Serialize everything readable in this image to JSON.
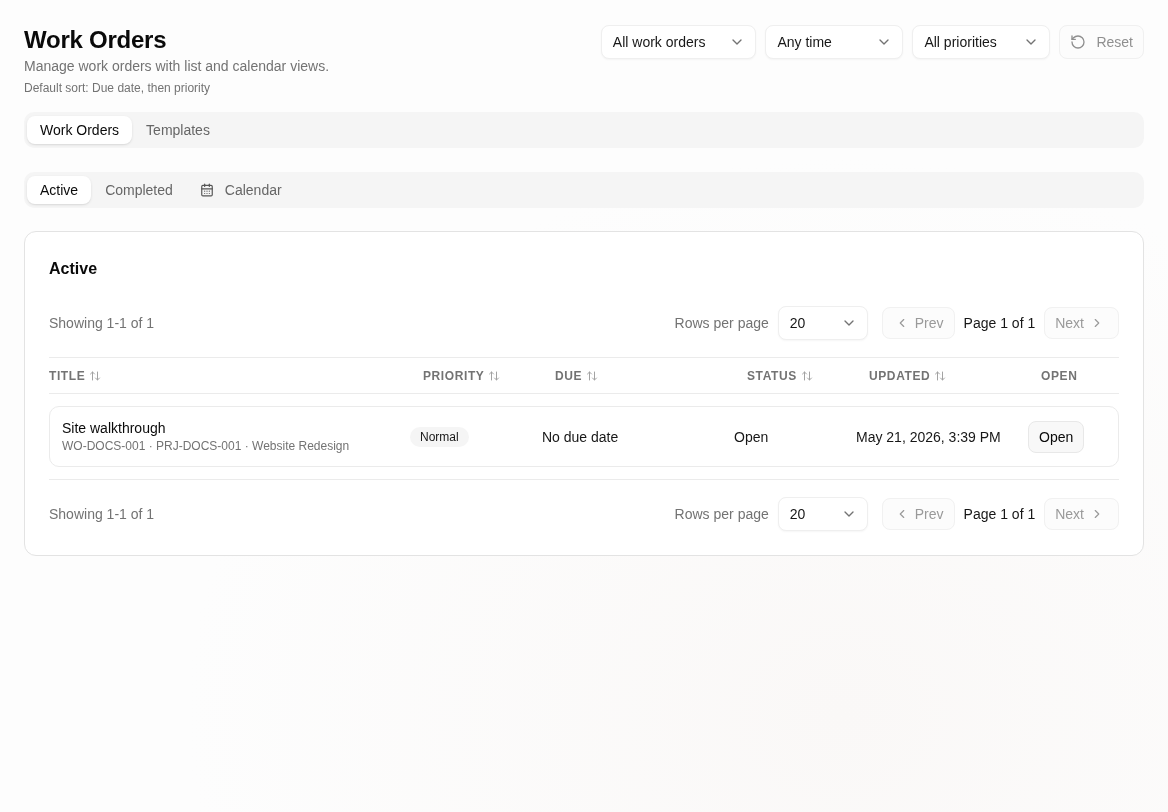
{
  "header": {
    "title": "Work Orders",
    "subtitle": "Manage work orders with list and calendar views.",
    "sort_note": "Default sort: Due date, then priority"
  },
  "filters": [
    {
      "value": "All work orders"
    },
    {
      "value": "Any time"
    },
    {
      "value": "All priorities"
    }
  ],
  "reset_button": {
    "label": "Reset",
    "disabled": true
  },
  "main_tabs": [
    {
      "label": "Work Orders",
      "selected": true
    },
    {
      "label": "Templates",
      "selected": false
    }
  ],
  "view_tabs": [
    {
      "label": "Active",
      "selected": true,
      "kind": "plain"
    },
    {
      "label": "Completed",
      "selected": false,
      "kind": "plain"
    },
    {
      "label": "Calendar",
      "selected": false,
      "kind": "calendar"
    }
  ],
  "panel": {
    "title": "Active",
    "pagination_top": {
      "summary": "Showing 1-1 of 1",
      "rows_label": "Rows per page",
      "rows_value": "20",
      "prev": {
        "label": "Prev",
        "disabled": true
      },
      "page": "Page 1 of 1",
      "next": {
        "label": "Next",
        "disabled": true
      }
    },
    "table": {
      "columns": [
        {
          "label": "TITLE",
          "sortable": true
        },
        {
          "label": "PRIORITY",
          "sortable": true
        },
        {
          "label": "DUE",
          "sortable": true
        },
        {
          "label": "STATUS",
          "sortable": true
        },
        {
          "label": "UPDATED",
          "sortable": true
        },
        {
          "label": "OPEN",
          "sortable": false
        }
      ],
      "rows": [
        {
          "title": "Site walkthrough",
          "meta": "WO-DOCS-001 · PRJ-DOCS-001 · Website Redesign",
          "priority": "Normal",
          "due": "No due date",
          "status": "Open",
          "updated": "May 21, 2026, 3:39 PM",
          "action": "Open"
        }
      ]
    },
    "pagination_bottom": {
      "summary": "Showing 1-1 of 1",
      "rows_label": "Rows per page",
      "rows_value": "20",
      "prev": {
        "label": "Prev",
        "disabled": true
      },
      "page": "Page 1 of 1",
      "next": {
        "label": "Next",
        "disabled": true
      }
    }
  }
}
